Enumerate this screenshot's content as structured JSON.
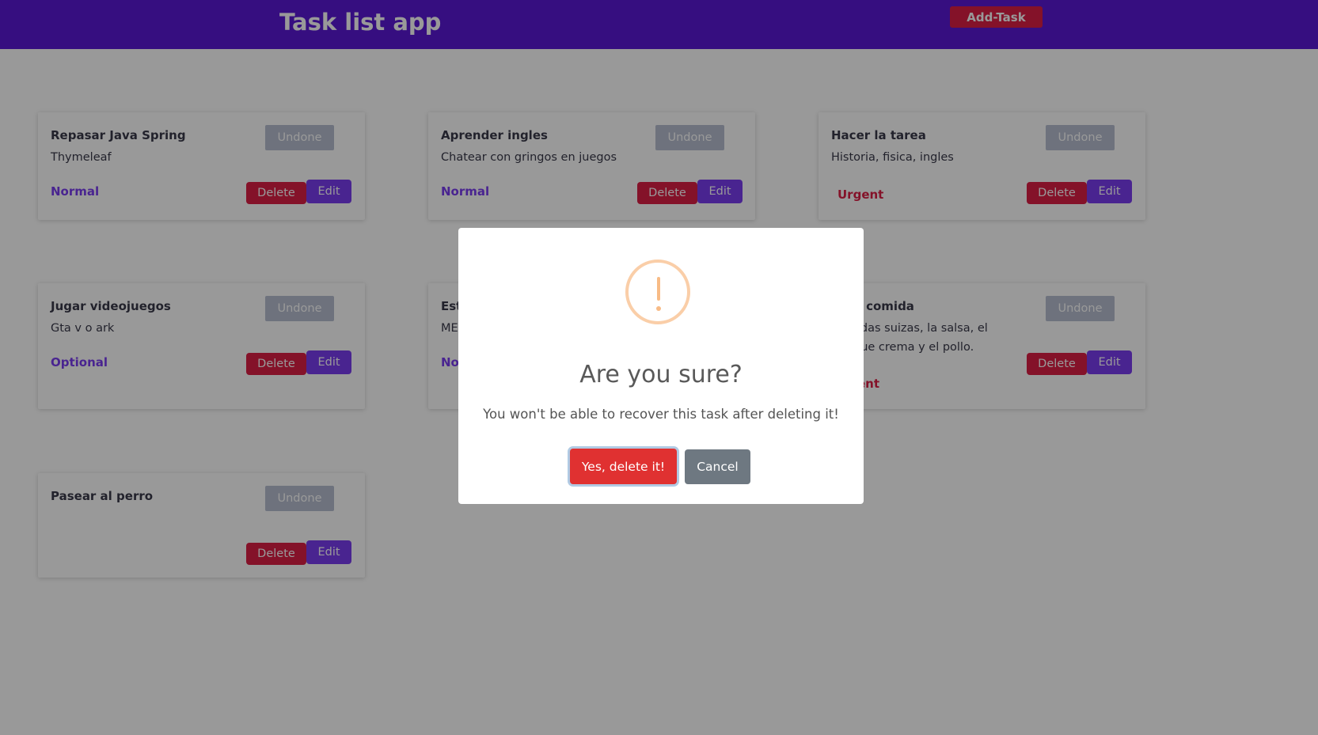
{
  "header": {
    "title": "Task list app",
    "add_task_label": "Add-Task"
  },
  "common": {
    "undone_label": "Undone",
    "delete_label": "Delete",
    "edit_label": "Edit"
  },
  "colors": {
    "normal": "#7a3cf0",
    "optional": "#7a3cf0",
    "urgent": "#dc1f45"
  },
  "tasks": [
    {
      "title": "Repasar Java Spring",
      "description": "Thymeleaf",
      "priority": "Normal"
    },
    {
      "title": "Aprender ingles",
      "description": "Chatear con gringos en juegos",
      "priority": "Normal"
    },
    {
      "title": "Hacer la tarea",
      "description": "Historia, fisica, ingles",
      "priority": "Urgent"
    },
    {
      "title": "Jugar videojuegos",
      "description": "Gta v o ark",
      "priority": "Optional"
    },
    {
      "title": "Est",
      "description": "ME",
      "priority": "No"
    },
    {
      "title": "r la comida",
      "description": "adas suizas, la salsa, el que crema y el pollo.",
      "priority": "ent"
    },
    {
      "title": "Pasear al perro",
      "description": "",
      "priority": ""
    }
  ],
  "dialog": {
    "icon": "warning-icon",
    "title": "Are you sure?",
    "text": "You won't be able to recover this task after deleting it!",
    "confirm_label": "Yes, delete it!",
    "cancel_label": "Cancel"
  }
}
